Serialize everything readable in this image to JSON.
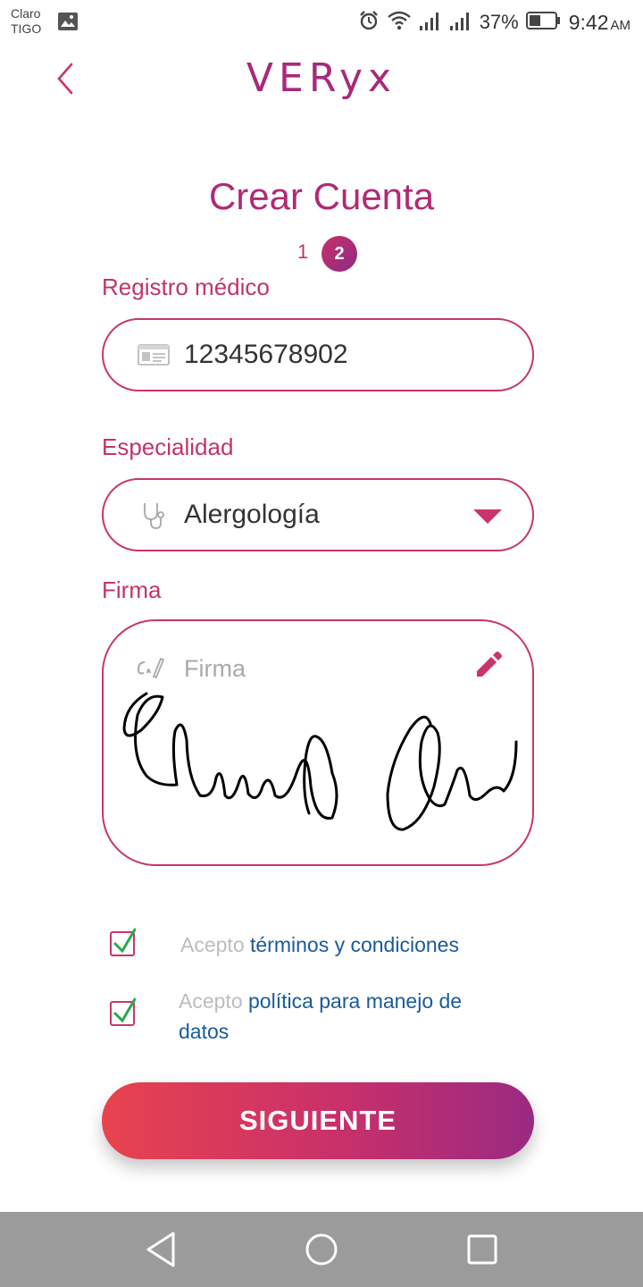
{
  "status_bar": {
    "carrier_line1": "Claro",
    "carrier_line2": "TIGO",
    "battery_percent": "37%",
    "time": "9:42",
    "ampm": "AM"
  },
  "header": {
    "logo": "VERyx"
  },
  "page": {
    "title": "Crear Cuenta",
    "step_inactive": "1",
    "step_active": "2"
  },
  "form": {
    "registro": {
      "label": "Registro médico",
      "value": "12345678902"
    },
    "especialidad": {
      "label": "Especialidad",
      "value": "Alergología"
    },
    "firma": {
      "label": "Firma",
      "placeholder": "Firma"
    }
  },
  "consents": {
    "terms": {
      "prefix": "Acepto",
      "link": "términos y condiciones",
      "checked": true
    },
    "privacy": {
      "prefix": "Acepto",
      "link": "política para manejo de datos",
      "checked": true
    }
  },
  "actions": {
    "next_label": "SIGUIENTE"
  },
  "colors": {
    "accent": "#c8356b",
    "brand": "#a8297a",
    "link": "#1a5a9c",
    "check": "#2aa84a"
  }
}
